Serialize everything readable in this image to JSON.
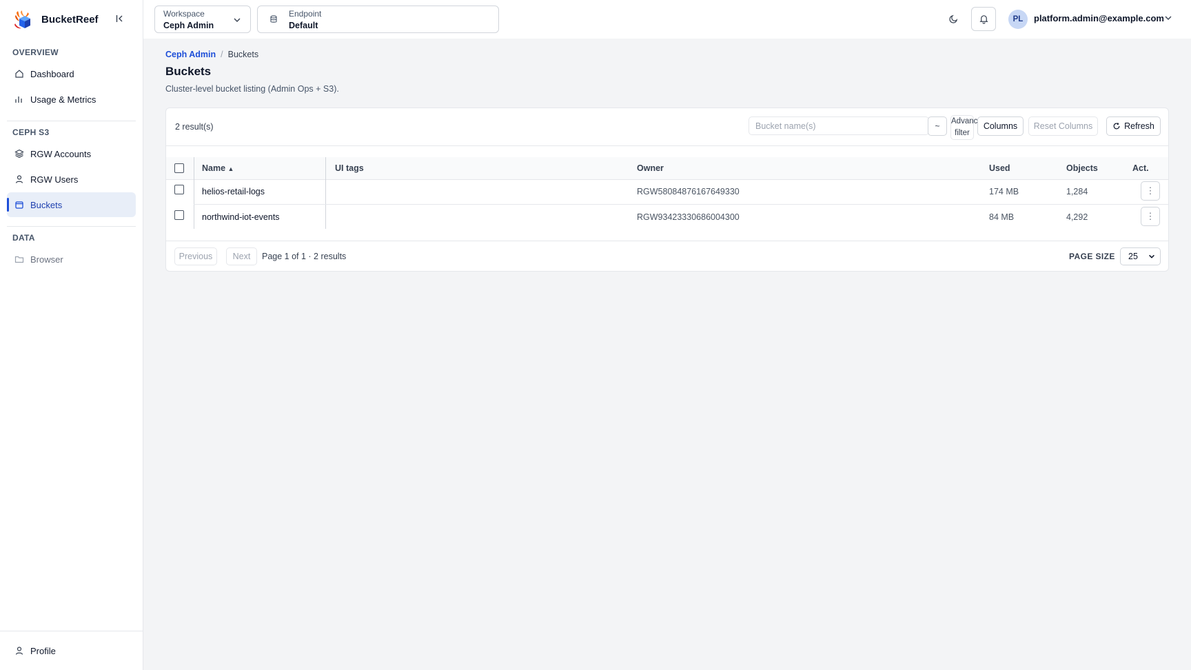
{
  "app": {
    "name": "BucketReef"
  },
  "sidebar": {
    "sections": [
      {
        "label": "OVERVIEW",
        "items": [
          {
            "label": "Dashboard"
          },
          {
            "label": "Usage & Metrics"
          }
        ]
      },
      {
        "label": "CEPH S3",
        "items": [
          {
            "label": "RGW Accounts"
          },
          {
            "label": "RGW Users"
          },
          {
            "label": "Buckets",
            "active": true
          }
        ]
      },
      {
        "label": "DATA",
        "items": [
          {
            "label": "Browser"
          }
        ]
      }
    ],
    "profile_label": "Profile"
  },
  "topbar": {
    "workspace": {
      "label": "Workspace",
      "value": "Ceph Admin"
    },
    "endpoint": {
      "label": "Endpoint",
      "value": "Default"
    },
    "user": {
      "initials": "PL",
      "email": "platform.admin@example.com"
    }
  },
  "breadcrumb": {
    "parent": "Ceph Admin",
    "separator": "/",
    "current": "Buckets"
  },
  "page": {
    "title": "Buckets",
    "subtitle": "Cluster-level bucket listing (Admin Ops + S3)."
  },
  "toolbar": {
    "results": "2 result(s)",
    "search_placeholder": "Bucket name(s)",
    "tilde": "~",
    "advanced_filter_line1": "Advanced",
    "advanced_filter_line2": "filter",
    "columns_label": "Columns",
    "reset_columns_label": "Reset Columns",
    "refresh_label": "Refresh"
  },
  "table": {
    "columns": {
      "name": "Name",
      "sort_indicator": "▲",
      "ui_tags": "UI tags",
      "owner": "Owner",
      "used": "Used",
      "objects": "Objects",
      "actions": "Act."
    },
    "rows": [
      {
        "name": "helios-retail-logs",
        "ui_tags": "",
        "owner": "RGW58084876167649330",
        "used": "174 MB",
        "objects": "1,284"
      },
      {
        "name": "northwind-iot-events",
        "ui_tags": "",
        "owner": "RGW93423330686004300",
        "used": "84 MB",
        "objects": "4,292"
      }
    ]
  },
  "pagination": {
    "previous_label": "Previous",
    "next_label": "Next",
    "info": "Page 1 of 1 · 2 results",
    "page_size_label": "PAGE SIZE",
    "page_size_value": "25"
  },
  "colors": {
    "accent": "#1d4ed8",
    "active_bg": "#e8eef8",
    "avatar_bg": "#c7d7f5"
  }
}
